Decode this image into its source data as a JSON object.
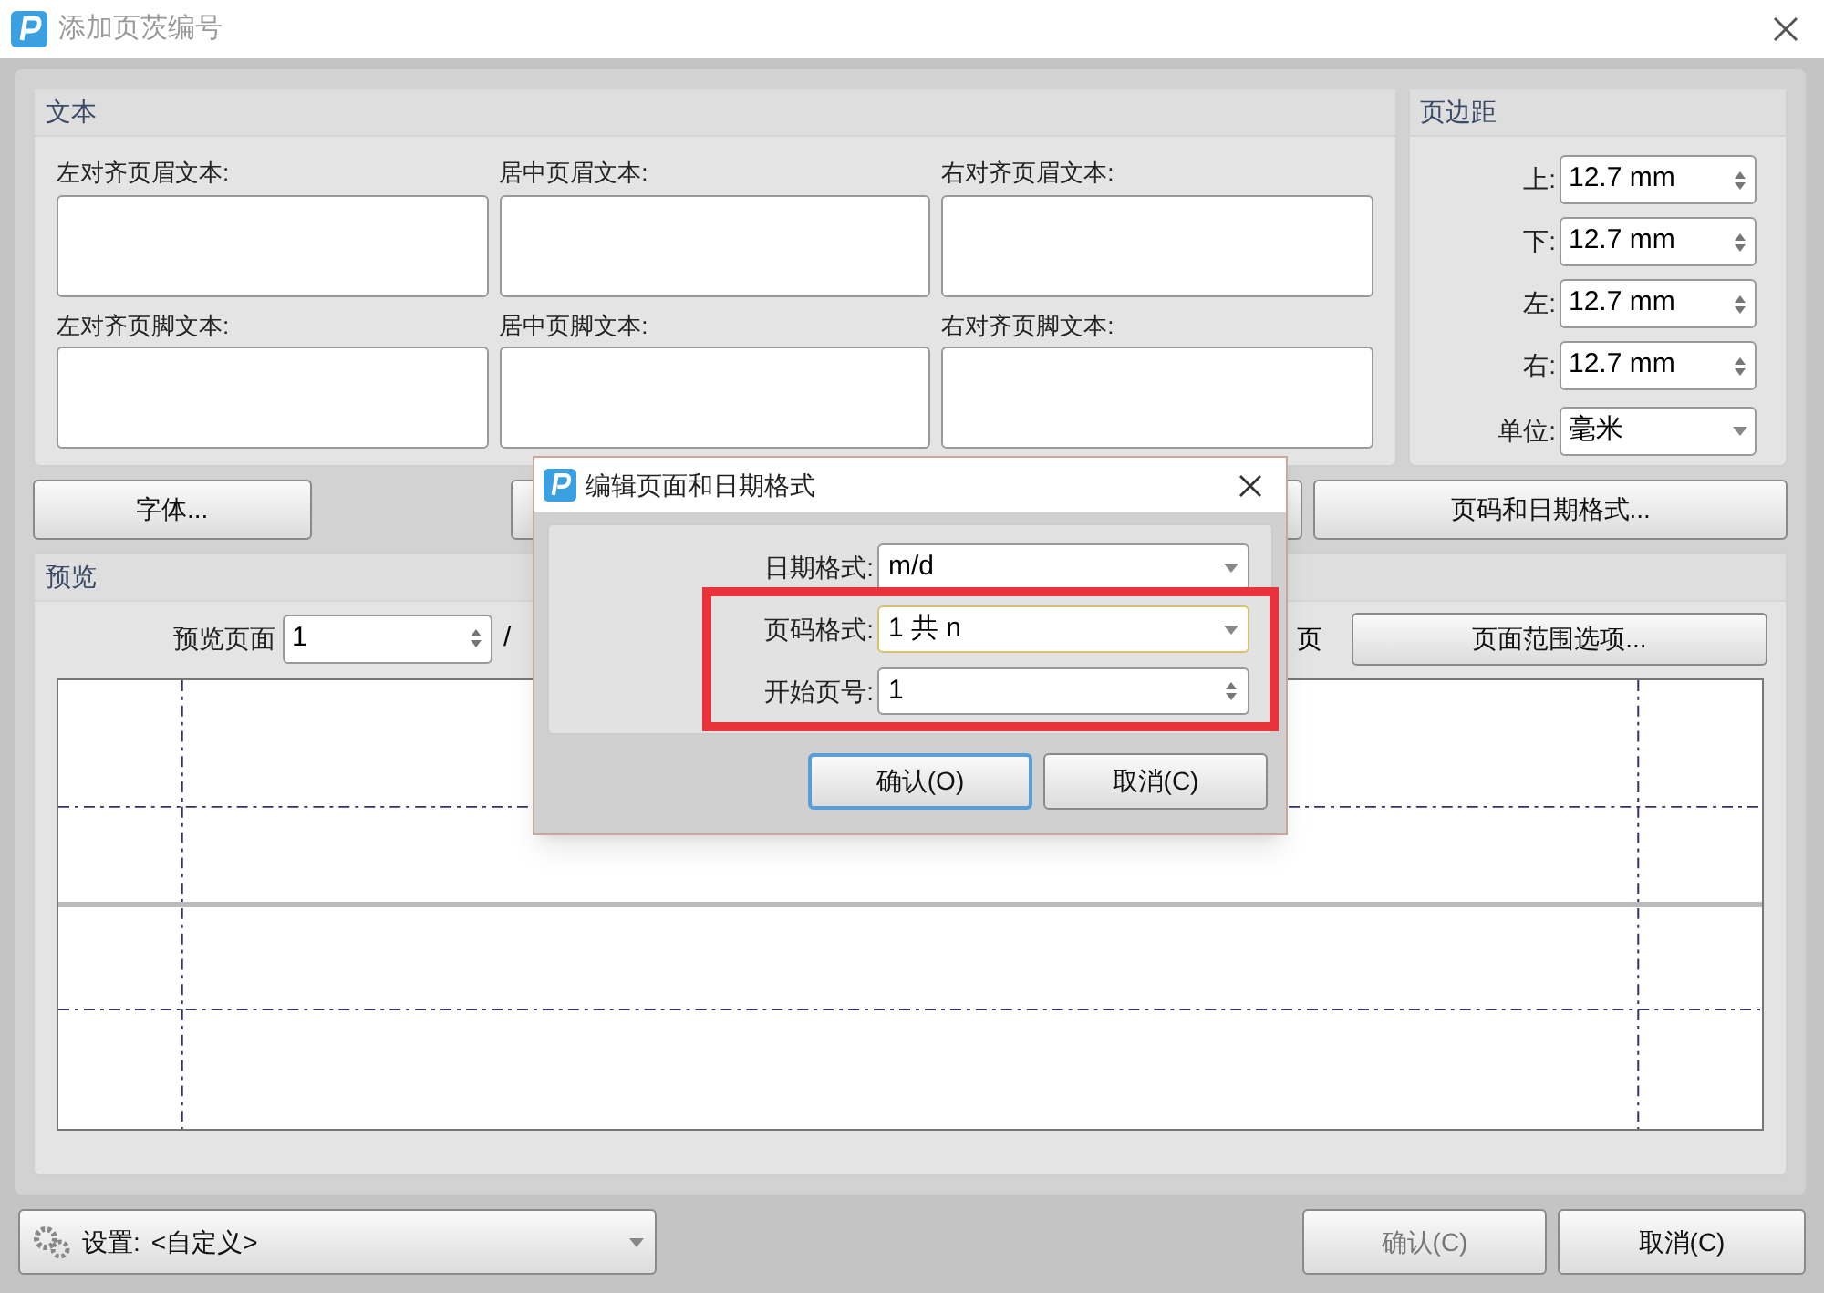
{
  "window": {
    "title": "添加页茨编号"
  },
  "text_group": {
    "title": "文本",
    "fields": [
      {
        "label": "左对齐页眉文本:"
      },
      {
        "label": "居中页眉文本:"
      },
      {
        "label": "右对齐页眉文本:"
      },
      {
        "label": "左对齐页脚文本:"
      },
      {
        "label": "居中页脚文本:"
      },
      {
        "label": "右对齐页脚文本:"
      }
    ]
  },
  "margins": {
    "title": "页边距",
    "spinners": [
      {
        "label": "上:",
        "value": "12.7 mm"
      },
      {
        "label": "下:",
        "value": "12.7 mm"
      },
      {
        "label": "左:",
        "value": "12.7 mm"
      },
      {
        "label": "右:",
        "value": "12.7 mm"
      }
    ],
    "unit": {
      "label": "单位:",
      "value": "毫米"
    }
  },
  "buttons": {
    "font": "字体...",
    "format": "页码和日期格式..."
  },
  "preview": {
    "title": "预览",
    "page_label": "预览页面",
    "page_value": "1",
    "slash": "/",
    "pages_suffix": "页",
    "range_button": "页面范围选项..."
  },
  "footer": {
    "settings_label": "设置:",
    "settings_value": "<自定义>",
    "ok": "确认(C)",
    "cancel": "取消(C)"
  },
  "popup": {
    "title": "编辑页面和日期格式",
    "date_format": {
      "label": "日期格式:",
      "value": "m/d"
    },
    "page_format": {
      "label": "页码格式:",
      "value": "1 共 n",
      "focused": true
    },
    "start_page": {
      "label": "开始页号:",
      "value": "1"
    },
    "highlighted": true,
    "ok": {
      "label": "确认(O)",
      "selected": true
    },
    "cancel": {
      "label": "取消(C)",
      "selected": false
    }
  }
}
